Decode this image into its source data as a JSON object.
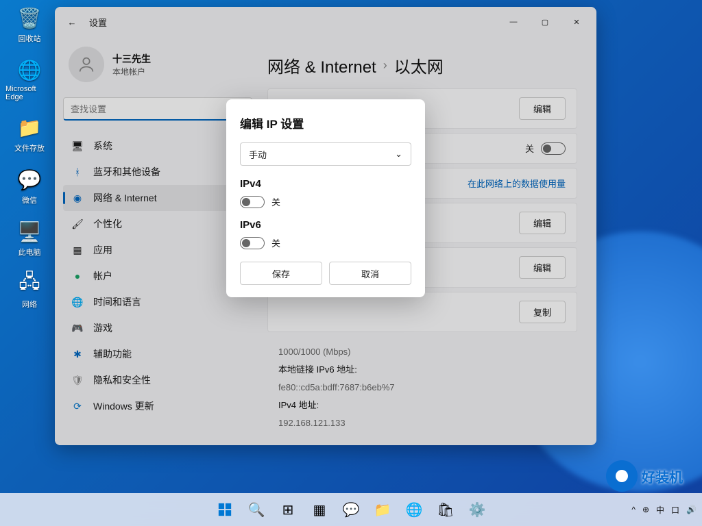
{
  "desktop": {
    "icons": [
      "回收站",
      "Microsoft Edge",
      "文件存放",
      "微信",
      "此电脑",
      "网络"
    ]
  },
  "window": {
    "title": "设置",
    "profile": {
      "name": "十三先生",
      "sub": "本地帐户"
    },
    "search_placeholder": "查找设置",
    "nav": [
      "系统",
      "蓝牙和其他设备",
      "网络 & Internet",
      "个性化",
      "应用",
      "帐户",
      "时间和语言",
      "游戏",
      "辅助功能",
      "隐私和安全性",
      "Windows 更新"
    ],
    "crumb": {
      "a": "网络 & Internet",
      "b": "以太网"
    },
    "rows": {
      "edit1": "编辑",
      "toggle_off": "关",
      "link": "在此网络上的数据使用量",
      "edit2": "编辑",
      "edit3": "编辑",
      "copy": "复制"
    },
    "details": {
      "speed": "1000/1000 (Mbps)",
      "l1": "本地链接 IPv6 地址:",
      "v1": "fe80::cd5a:bdff:7687:b6eb%7",
      "l2": "IPv4 地址:",
      "v2": "192.168.121.133"
    }
  },
  "modal": {
    "title": "编辑 IP 设置",
    "select": "手动",
    "ipv4": "IPv4",
    "ipv6": "IPv6",
    "off": "关",
    "save": "保存",
    "cancel": "取消"
  },
  "tray": {
    "lang": "中",
    "ime": "口"
  },
  "watermark": "好装机"
}
